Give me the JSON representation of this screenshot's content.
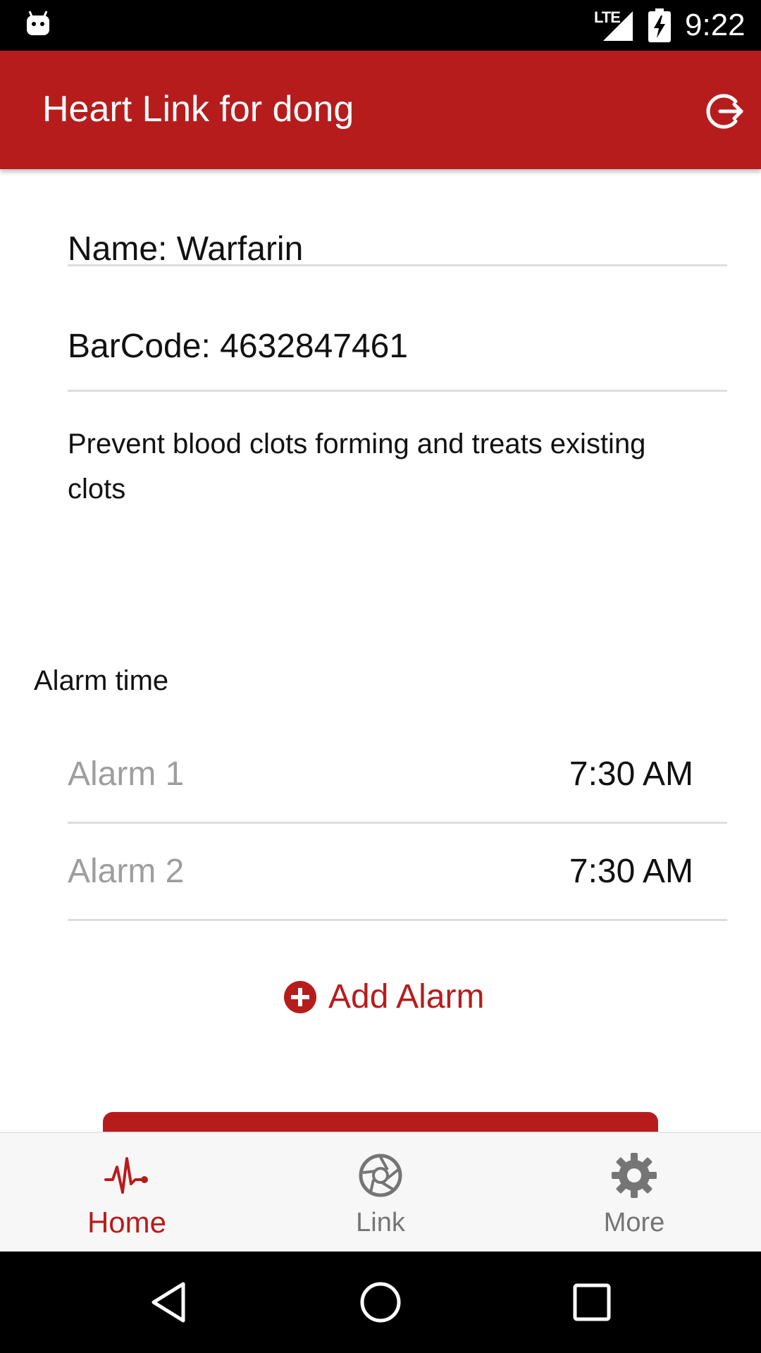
{
  "status_bar": {
    "network_label": "LTE",
    "time": "9:22",
    "icons": [
      "android-icon",
      "signal-icon",
      "battery-charging-icon"
    ]
  },
  "app_bar": {
    "title": "Heart Link for dong",
    "action_icon": "logout-icon"
  },
  "medication": {
    "name": "Name: Warfarin",
    "barcode": "BarCode: 4632847461",
    "description": "Prevent blood clots forming and treats existing clots"
  },
  "alarms": {
    "heading": "Alarm time",
    "items": [
      {
        "label": "Alarm 1",
        "time": "7:30 AM"
      },
      {
        "label": "Alarm 2",
        "time": "7:30 AM"
      }
    ],
    "add_label": "Add Alarm",
    "add_icon": "plus-circle-icon"
  },
  "bottom_nav": {
    "items": [
      {
        "label": "Home",
        "icon": "heartbeat-icon",
        "active": true
      },
      {
        "label": "Link",
        "icon": "aperture-icon",
        "active": false
      },
      {
        "label": "More",
        "icon": "gear-icon",
        "active": false
      }
    ]
  },
  "colors": {
    "primary": "#b71c1c",
    "inactive": "#757575",
    "hint": "#9e9e9e",
    "divider": "#dddddd"
  }
}
